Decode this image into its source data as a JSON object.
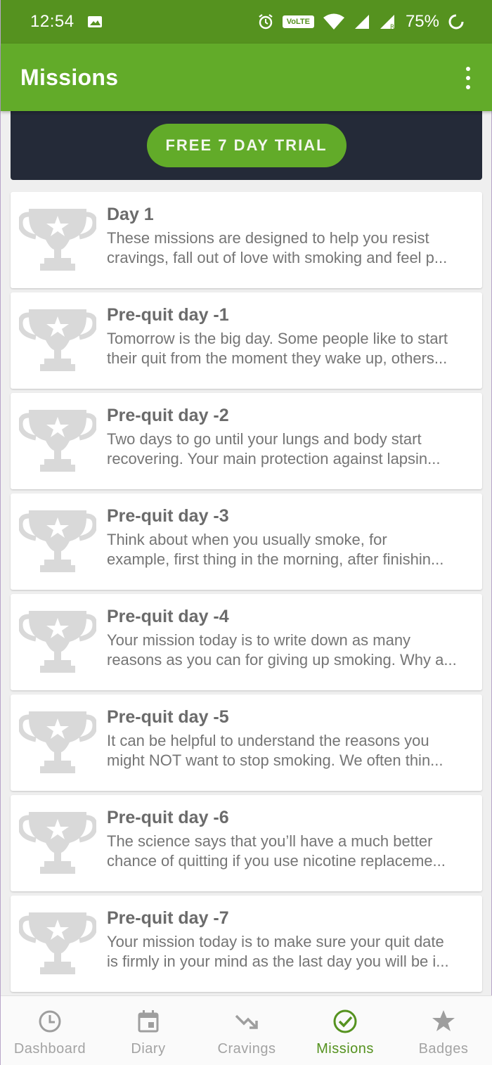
{
  "status_bar": {
    "time": "12:54",
    "volte": "VoLTE",
    "battery": "75%"
  },
  "app_bar": {
    "title": "Missions",
    "icons": [
      "overflow-menu-icon"
    ]
  },
  "banner": {
    "trial_button": "FREE 7 DAY TRIAL"
  },
  "missions": [
    {
      "title": "Day 1",
      "line1": "These missions are designed to help you resist",
      "line2": "cravings, fall out of love with smoking and feel p..."
    },
    {
      "title": "Pre-quit day -1",
      "line1": "Tomorrow is the big day. Some people like to start",
      "line2": "their quit from the moment they wake up, others..."
    },
    {
      "title": "Pre-quit day -2",
      "line1": "Two days to go until your lungs and body start",
      "line2": "recovering. Your main protection against lapsin..."
    },
    {
      "title": "Pre-quit day -3",
      "line1": "Think about when you usually smoke, for",
      "line2": "example, first thing in the morning, after finishin..."
    },
    {
      "title": "Pre-quit day -4",
      "line1": "Your mission today is to write down as many",
      "line2": "reasons as you can for giving up smoking. Why a..."
    },
    {
      "title": "Pre-quit day -5",
      "line1": "It can be helpful to understand the reasons you",
      "line2": "might NOT want to stop smoking. We often thin..."
    },
    {
      "title": "Pre-quit day -6",
      "line1": "The science says that you’ll have a much better",
      "line2": "chance of quitting if you use nicotine replaceme..."
    },
    {
      "title": "Pre-quit day -7",
      "line1": "Your mission today is to make sure your quit date",
      "line2": "is firmly in your mind as the last day you will be i..."
    }
  ],
  "bottom_nav": [
    {
      "label": "Dashboard",
      "icon": "clock-icon"
    },
    {
      "label": "Diary",
      "icon": "calendar-icon"
    },
    {
      "label": "Cravings",
      "icon": "trend-down-icon"
    },
    {
      "label": "Missions",
      "icon": "check-circle-icon",
      "active": true
    },
    {
      "label": "Badges",
      "icon": "star-icon"
    }
  ],
  "colors": {
    "status_bar": "#55921f",
    "app_bar": "#62ab29",
    "banner": "#242a38",
    "active_nav": "#55921f",
    "trophy": "#d9d9d9"
  }
}
